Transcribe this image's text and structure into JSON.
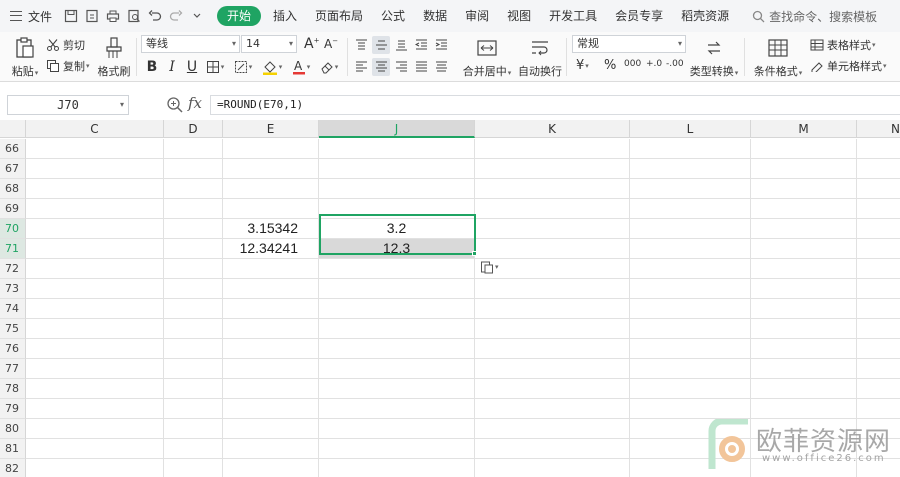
{
  "menubar": {
    "file_label": "文件",
    "tabs": [
      "开始",
      "插入",
      "页面布局",
      "公式",
      "数据",
      "审阅",
      "视图",
      "开发工具",
      "会员专享",
      "稻壳资源"
    ],
    "active_tab": "开始",
    "search_text": "查找命令、搜索模板"
  },
  "ribbon": {
    "paste_label": "粘贴",
    "cut_label": "剪切",
    "copy_label": "复制",
    "format_painter_label": "格式刷",
    "font_name": "等线",
    "font_size": "14",
    "merge_label": "合并居中",
    "wrap_label": "自动换行",
    "number_format": "常规",
    "currency_symbol": "¥",
    "percent_symbol": "%",
    "thousands_label": "000",
    "inc_decimal_label": "+.0",
    "dec_decimal_label": "-.00",
    "type_convert_label": "类型转换",
    "conditional_format_label": "条件格式",
    "table_style_label": "表格样式",
    "cell_style_label": "单元格样式"
  },
  "formula_bar": {
    "cell_ref": "J70",
    "fx_label": "fx",
    "formula": "=ROUND(E70,1)"
  },
  "grid": {
    "columns": [
      "C",
      "D",
      "E",
      "J",
      "K",
      "L",
      "M",
      "N"
    ],
    "selected_column": "J",
    "rows": [
      "66",
      "67",
      "68",
      "69",
      "70",
      "71",
      "72",
      "73",
      "74",
      "75",
      "76",
      "77",
      "78",
      "79",
      "80",
      "81",
      "82"
    ],
    "selected_rows": [
      "70",
      "71"
    ],
    "values": {
      "E70": "3.15342",
      "E71": "12.34241",
      "J70": "3.2",
      "J71": "12.3"
    }
  },
  "watermark": {
    "title": "欧菲资源网",
    "url": "www.office26.com"
  },
  "colors": {
    "accent": "#1fa463",
    "selection_fill": "#d9d9d9",
    "header_bg": "#f2f2f2"
  }
}
